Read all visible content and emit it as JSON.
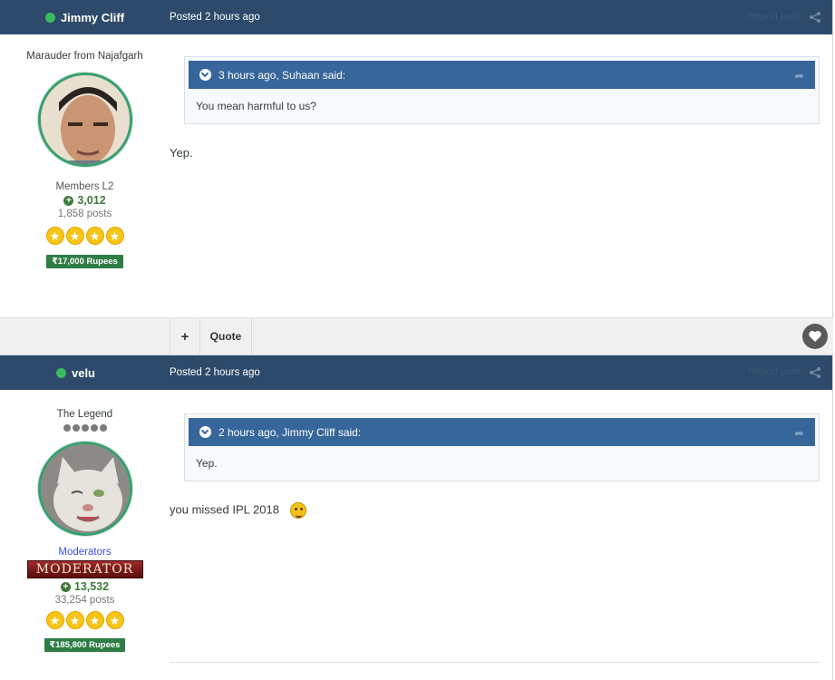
{
  "posts": [
    {
      "author": "Jimmy Cliff",
      "posted": "Posted 2 hours ago",
      "report": "Report post",
      "title": "Marauder from Najafgarh",
      "group": "Members L2",
      "reputation": "3,012",
      "post_count": "1,858 posts",
      "rupees": "₹17,000 Rupees",
      "quote_header": "3 hours ago, Suhaan said:",
      "quote_text": "You mean harmful to us?",
      "body": "Yep.",
      "stars": 4
    },
    {
      "author": "velu",
      "posted": "Posted 2 hours ago",
      "report": "Report post",
      "title": "The Legend",
      "group": "Moderators",
      "badge": "MODERATOR",
      "reputation": "13,532",
      "post_count": "33,254 posts",
      "rupees": "₹185,800 Rupees",
      "quote_header": "2 hours ago, Jimmy Cliff said:",
      "quote_text": "Yep.",
      "body": "you missed IPL 2018",
      "stars": 4
    }
  ],
  "toolbar": {
    "plus": "+",
    "quote": "Quote"
  },
  "icons": {
    "online": "online-dot-icon",
    "share": "share-icon",
    "reputation": "plus-circle-icon",
    "like": "heart-icon",
    "star": "star-icon",
    "expand": "chevron-down-icon",
    "emoji": "laughing-emoji-icon"
  },
  "colors": {
    "header": "#2d4a6a",
    "quote_header": "#37669a",
    "online": "#3cb85e",
    "rupees": "#2e7d45"
  }
}
